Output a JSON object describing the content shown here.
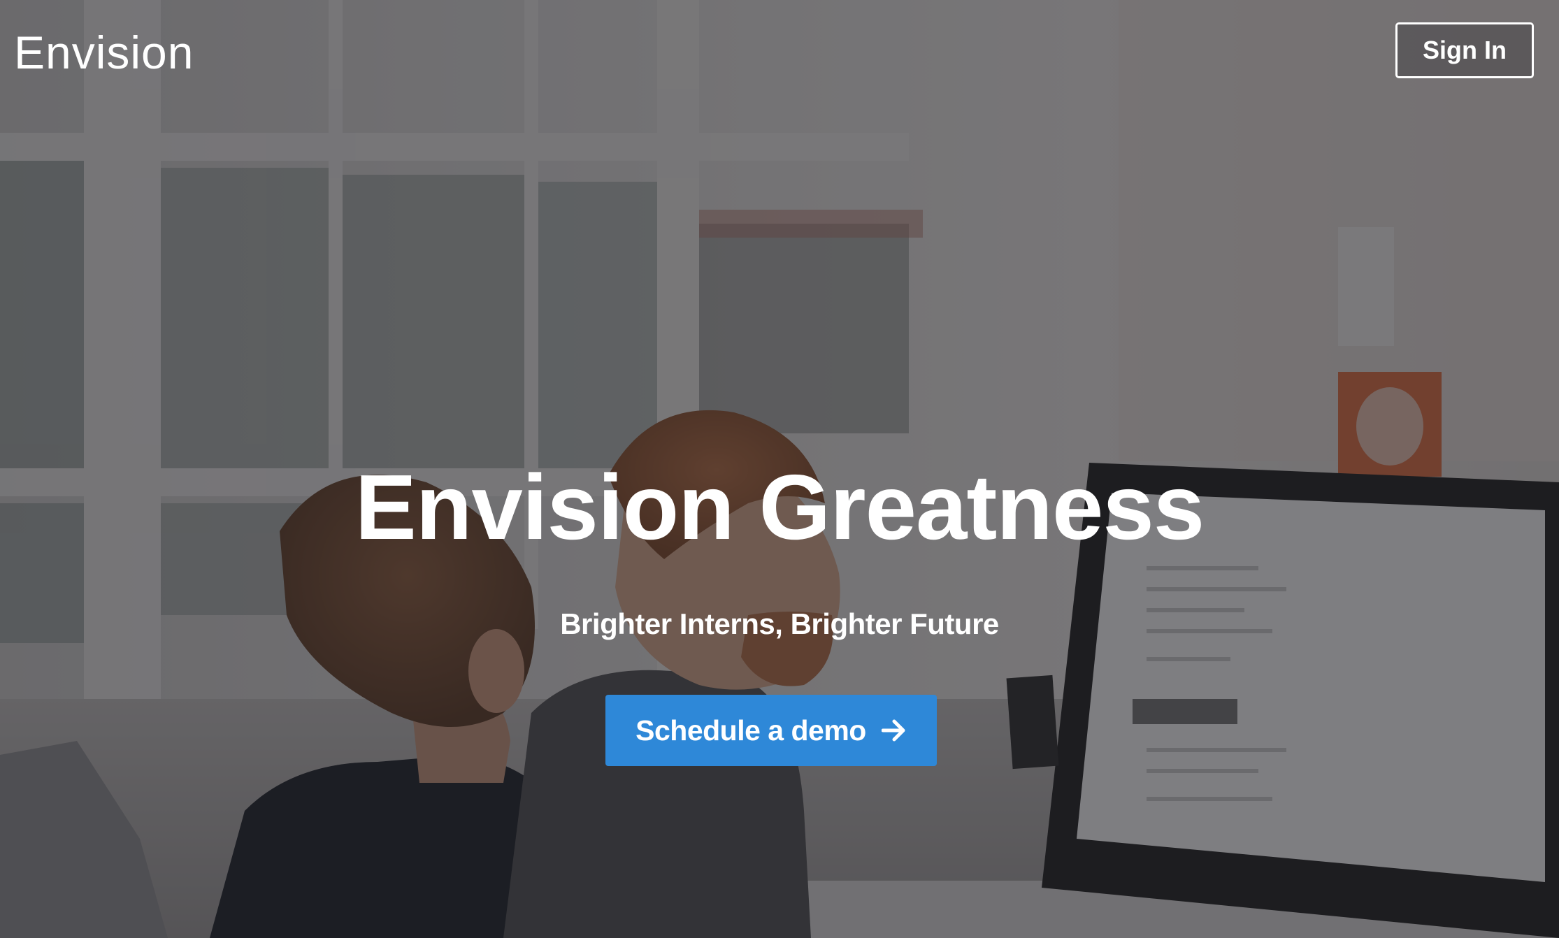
{
  "header": {
    "logo_text": "Envision",
    "signin_label": "Sign In"
  },
  "hero": {
    "headline": "Envision Greatness",
    "subheadline": "Brighter Interns, Brighter Future",
    "cta_label": "Schedule a demo",
    "cta_icon": "arrow-right-icon",
    "background": "office-photo-two-people-at-computer"
  },
  "colors": {
    "cta_background": "#2e88d8",
    "text": "#ffffff",
    "overlay": "#2a2a2e"
  }
}
